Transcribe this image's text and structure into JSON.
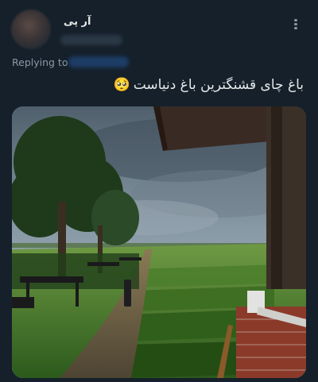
{
  "author": {
    "display_name": "آر پی"
  },
  "reply_context": {
    "label": "Replying to"
  },
  "tweet": {
    "text": "باغ چای قشنگترین باغ دنیاست",
    "emoji": "🥺"
  },
  "icons": {
    "more": "more-vertical-icon",
    "media": "photo-icon"
  },
  "colors": {
    "background": "#15202b",
    "primary_text": "#e7e9ea",
    "secondary_text": "#8b98a5"
  }
}
